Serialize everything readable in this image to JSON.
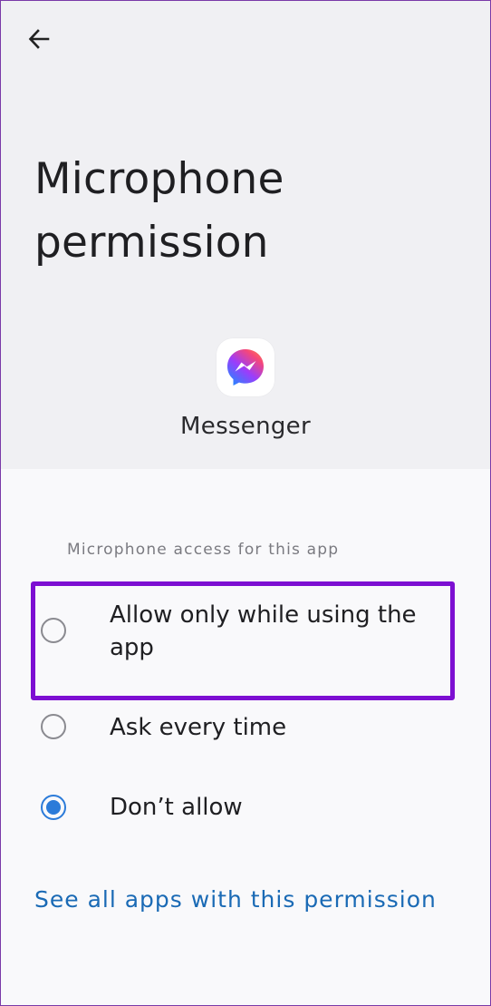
{
  "header": {
    "title": "Microphone permission",
    "app_name": "Messenger"
  },
  "permissions": {
    "section_label": "Microphone access for this app",
    "options": [
      {
        "label": "Allow only while using the app",
        "selected": false,
        "highlighted": true
      },
      {
        "label": "Ask every time",
        "selected": false
      },
      {
        "label": "Don’t allow",
        "selected": true
      }
    ],
    "see_all_link": "See all apps with this permission"
  },
  "colors": {
    "accent": "#2b7bd9",
    "link": "#1a6ab5",
    "highlight": "#7d0fd2"
  },
  "icons": {
    "back": "arrow-left-icon",
    "app": "messenger-icon"
  }
}
